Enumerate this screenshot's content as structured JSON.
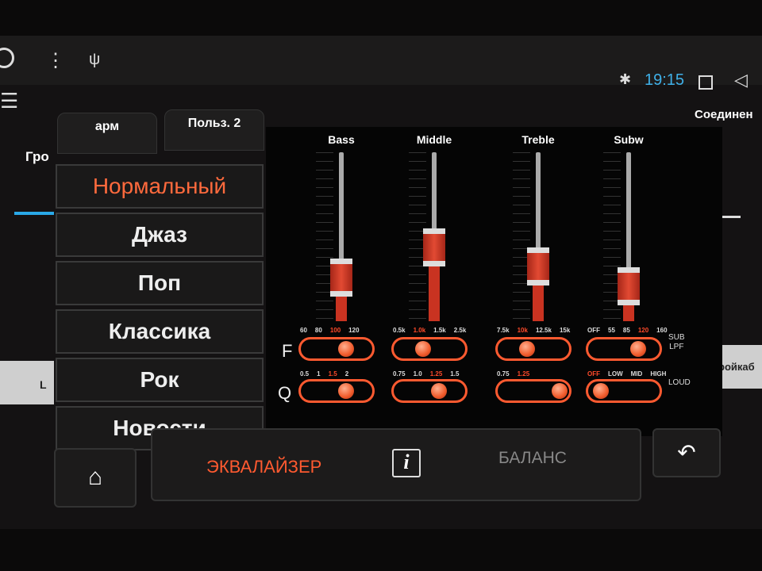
{
  "status_bar": {
    "time": "19:15",
    "icons": [
      "circle-icon",
      "menu-dots-icon",
      "usb-icon",
      "bluetooth-icon",
      "square-icon",
      "back-triangle-icon"
    ]
  },
  "background": {
    "left_label": "Гро",
    "right_label": "Соединен",
    "bottom_right_label": "ройкаб",
    "bottom_left_label": "L"
  },
  "tabs": [
    {
      "label": "арм"
    },
    {
      "label": "Польз. 2"
    }
  ],
  "presets": [
    {
      "label": "Нормальный",
      "active": true
    },
    {
      "label": "Джаз"
    },
    {
      "label": "Поп"
    },
    {
      "label": "Классика"
    },
    {
      "label": "Рок"
    },
    {
      "label": "Новости"
    }
  ],
  "equalizer": {
    "row_labels": {
      "f": "F",
      "q": "Q"
    },
    "bands": [
      {
        "name": "Bass",
        "level": 0.35,
        "f_options": [
          "60",
          "80",
          "100",
          "120"
        ],
        "f_selected": "100",
        "q_options": [
          "0.5",
          "1",
          "1.5",
          "2"
        ],
        "q_selected": "1.5"
      },
      {
        "name": "Middle",
        "level": 0.53,
        "f_options": [
          "0.5k",
          "1.0k",
          "1.5k",
          "2.5k"
        ],
        "f_selected": "1.0k",
        "q_options": [
          "0.75",
          "1.0",
          "1.25",
          "1.5"
        ],
        "q_selected": "1.25"
      },
      {
        "name": "Treble",
        "level": 0.42,
        "f_options": [
          "7.5k",
          "10k",
          "12.5k",
          "15k"
        ],
        "f_selected": "10k",
        "q_options": [
          "0.75",
          "1.25"
        ],
        "q_selected": "1.25"
      },
      {
        "name": "Subw",
        "level": 0.3,
        "f_options": [
          "OFF",
          "55",
          "85",
          "120",
          "160"
        ],
        "f_selected": "120",
        "q_options": [
          "OFF",
          "LOW",
          "MID",
          "HIGH"
        ],
        "q_selected": "OFF"
      }
    ],
    "sub_lpf_label": [
      "SUB",
      "LPF"
    ],
    "loud_label": "LOUD",
    "accent": "#ff5a30"
  },
  "bottom_bar": {
    "equalizer_label": "ЭКВАЛАЙЗЕР",
    "balance_label": "БАЛАНС",
    "info_label": "i"
  }
}
